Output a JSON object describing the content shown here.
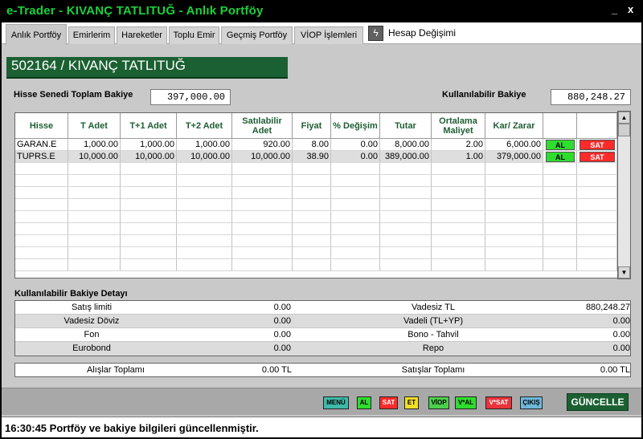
{
  "window": {
    "title": "e-Trader - KIVANÇ TATLITUĞ - Anlık Portföy",
    "minimize_label": "_",
    "close_label": "x"
  },
  "tabs": [
    {
      "label": "Anlık Portföy",
      "active": true
    },
    {
      "label": "Emirlerim"
    },
    {
      "label": "Hareketler"
    },
    {
      "label": "Toplu Emir"
    },
    {
      "label": "Geçmiş Portföy"
    },
    {
      "label": "VİOP İşlemleri"
    }
  ],
  "hesap": {
    "icon": "lightning-icon",
    "glyph": "ϟ",
    "label": "Hesap Değişimi"
  },
  "client": {
    "header": "502164 / KIVANÇ TATLITUĞ"
  },
  "balances": {
    "hisse_label": "Hisse Senedi Toplam Bakiye",
    "hisse_value": "397,000.00",
    "kullanilabilir_label": "Kullanılabilir Bakiye",
    "kullanilabilir_value": "880,248.27"
  },
  "portfolio": {
    "columns": [
      "Hisse",
      "T Adet",
      "T+1 Adet",
      "T+2 Adet",
      "Satılabilir Adet",
      "Fiyat",
      "% Değişim",
      "Tutar",
      "Ortalama Maliyet",
      "Kar/ Zarar"
    ],
    "rows": [
      [
        "GARAN.E",
        "1,000.00",
        "1,000.00",
        "1,000.00",
        "920.00",
        "8.00",
        "0.00",
        "8,000.00",
        "2.00",
        "6,000.00"
      ],
      [
        "TUPRS.E",
        "10,000.00",
        "10,000.00",
        "10,000.00",
        "10,000.00",
        "38.90",
        "0.00",
        "389,000.00",
        "1.00",
        "379,000.00"
      ]
    ],
    "buy_label": "AL",
    "sell_label": "SAT",
    "scroll_up": "▲",
    "scroll_down": "▼"
  },
  "detail": {
    "title": "Kullanılabilir Bakiye Detayı",
    "rows": [
      {
        "l_label": "Satış limiti",
        "l_value": "0.00",
        "r_label": "Vadesiz TL",
        "r_value": "880,248.27"
      },
      {
        "l_label": "Vadesiz Döviz",
        "l_value": "0.00",
        "r_label": "Vadeli (TL+YP)",
        "r_value": "0.00"
      },
      {
        "l_label": "Fon",
        "l_value": "0.00",
        "r_label": "Bono - Tahvil",
        "r_value": "0.00"
      },
      {
        "l_label": "Eurobond",
        "l_value": "0.00",
        "r_label": "Repo",
        "r_value": "0.00"
      }
    ]
  },
  "totals": {
    "buy_label": "Alışlar Toplamı",
    "buy_value": "0.00 TL",
    "sell_label": "Satışlar Toplamı",
    "sell_value": "0.00 TL"
  },
  "toolbar": {
    "buttons": [
      {
        "label": "MENÜ",
        "bg": "#3fb9a9",
        "fg": "#000000"
      },
      {
        "label": "AL",
        "bg": "#2fdc2f",
        "fg": "#000000"
      },
      {
        "label": "SAT",
        "bg": "#ff2a2a",
        "fg": "#ffffff"
      },
      {
        "label": "ET",
        "bg": "#f2de29",
        "fg": "#000000"
      },
      {
        "label": "VİOP",
        "bg": "#4ccf4c",
        "fg": "#000000"
      },
      {
        "label": "V*AL",
        "bg": "#2fdc2f",
        "fg": "#000000"
      },
      {
        "label": "V*SAT",
        "bg": "#e8343a",
        "fg": "#ffffff"
      },
      {
        "label": "ÇIKIŞ",
        "bg": "#6fb7d9",
        "fg": "#000000"
      }
    ],
    "refresh_label": "GÜNCELLE"
  },
  "status": {
    "message": "16:30:45 Portföy ve bakiye bilgileri güncellenmiştir."
  },
  "colors": {
    "accent": "#1b6032",
    "title_text": "#19d23a"
  }
}
